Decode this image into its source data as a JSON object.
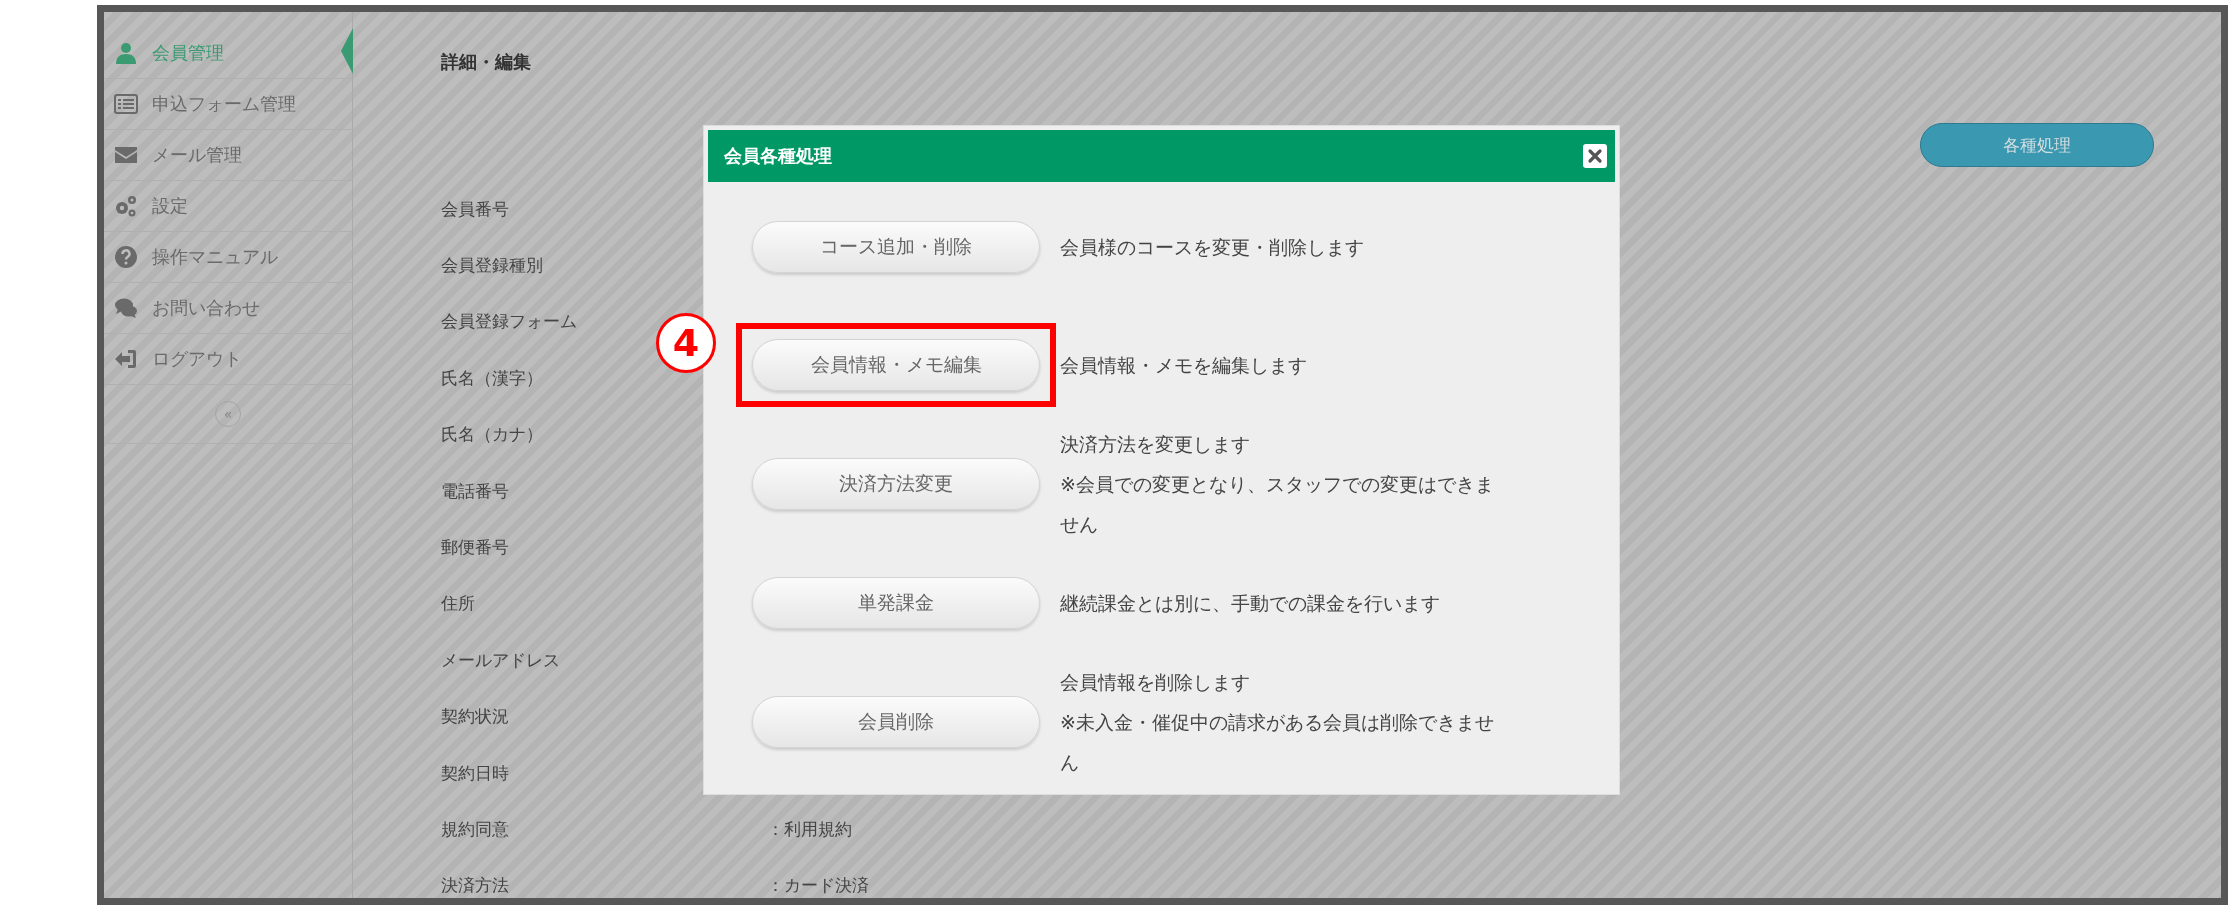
{
  "sidebar": {
    "items": [
      {
        "label": "会員管理",
        "selected": true
      },
      {
        "label": "申込フォーム管理",
        "selected": false
      },
      {
        "label": "メール管理",
        "selected": false
      },
      {
        "label": "設定",
        "selected": false
      },
      {
        "label": "操作マニュアル",
        "selected": false
      },
      {
        "label": "お問い合わせ",
        "selected": false
      },
      {
        "label": "ログアウト",
        "selected": false
      }
    ],
    "collapse_button": "«"
  },
  "page": {
    "title": "詳細・編集",
    "action_button": "各種処理",
    "fields": [
      {
        "label": "会員番号"
      },
      {
        "label": "会員登録種別"
      },
      {
        "label": "会員登録フォーム"
      },
      {
        "label": "氏名（漢字）"
      },
      {
        "label": "氏名（カナ）"
      },
      {
        "label": "電話番号"
      },
      {
        "label": "郵便番号"
      },
      {
        "label": "住所"
      },
      {
        "label": "メールアドレス"
      },
      {
        "label": "契約状況"
      },
      {
        "label": "契約日時"
      },
      {
        "label": "規約同意",
        "value": "：利用規約"
      },
      {
        "label": "決済方法",
        "value": "：カード決済"
      }
    ]
  },
  "dialog": {
    "title": "会員各種処理",
    "actions": [
      {
        "label": "コース追加・削除",
        "description": [
          "会員様のコースを変更・削除します"
        ],
        "highlighted": false
      },
      {
        "label": "会員情報・メモ編集",
        "description": [
          "会員情報・メモを編集します"
        ],
        "highlighted": true
      },
      {
        "label": "決済方法変更",
        "description": [
          "決済方法を変更します",
          "※会員での変更となり、スタッフでの変更はできません"
        ],
        "highlighted": false
      },
      {
        "label": "単発課金",
        "description": [
          "継続課金とは別に、手動での課金を行います"
        ],
        "highlighted": false
      },
      {
        "label": "会員削除",
        "description": [
          "会員情報を削除します",
          "※未入金・催促中の請求がある会員は削除できません"
        ],
        "highlighted": false
      }
    ]
  },
  "annotation": {
    "marker": "4"
  }
}
